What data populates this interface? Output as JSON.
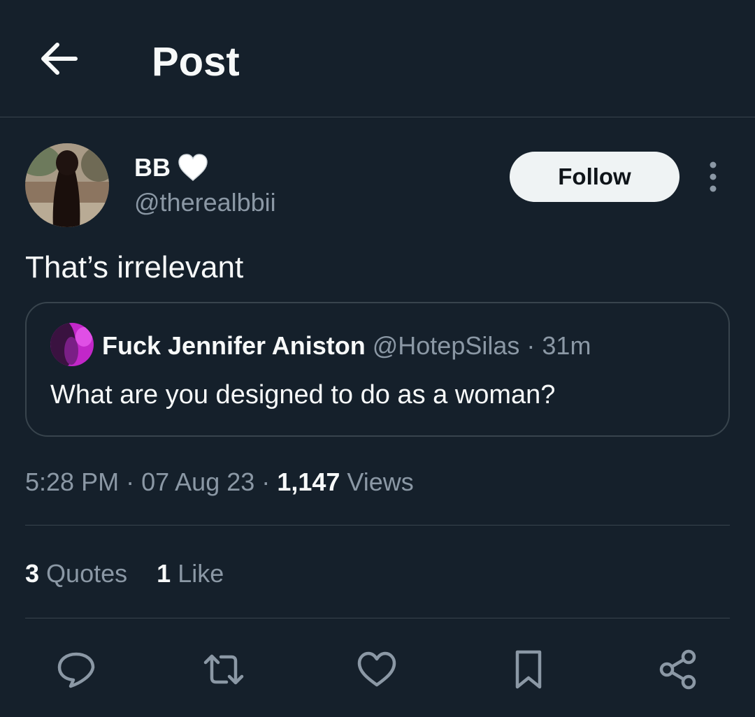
{
  "header": {
    "title": "Post"
  },
  "tweet": {
    "author_name": "BB",
    "author_emoji": "white-heart",
    "author_handle": "@therealbbii",
    "follow_label": "Follow",
    "text": "That’s irrelevant",
    "quoted": {
      "author_name": "Fuck Jennifer Aniston",
      "author_handle": "@HotepSilas",
      "separator": "·",
      "time": "31m",
      "text": "What are you designed to do as a woman?"
    },
    "meta": {
      "time": "5:28 PM",
      "sep1": "·",
      "date": "07 Aug 23",
      "sep2": "·",
      "views_count": "1,147",
      "views_label": "Views"
    },
    "stats": {
      "quotes_count": "3",
      "quotes_label": "Quotes",
      "likes_count": "1",
      "likes_label": "Like"
    }
  },
  "actions": [
    "reply-icon",
    "retweet-icon",
    "like-icon",
    "bookmark-icon",
    "share-icon"
  ],
  "colors": {
    "background": "#15202b",
    "border": "#38444d",
    "primary_text": "#f7f9f9",
    "secondary_text": "#8b98a5",
    "follow_button_bg": "#eff3f4"
  }
}
